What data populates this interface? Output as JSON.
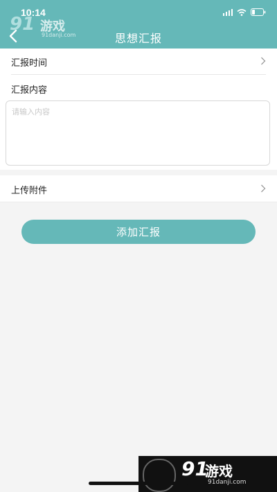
{
  "status_bar": {
    "time": "10:14"
  },
  "header": {
    "title": "思想汇报",
    "back_icon": "chevron-left-icon",
    "accent": "#65b8b8"
  },
  "watermark_top": {
    "number": "91",
    "name": "游戏",
    "url": "91danji.com"
  },
  "form": {
    "report_time_label": "汇报时间",
    "report_content_label": "汇报内容",
    "content_placeholder": "请输入内容",
    "attachment_label": "上传附件",
    "submit_label": "添加汇报"
  },
  "watermark_bottom": {
    "number": "91",
    "name": "游戏",
    "url": "91danji.com"
  }
}
